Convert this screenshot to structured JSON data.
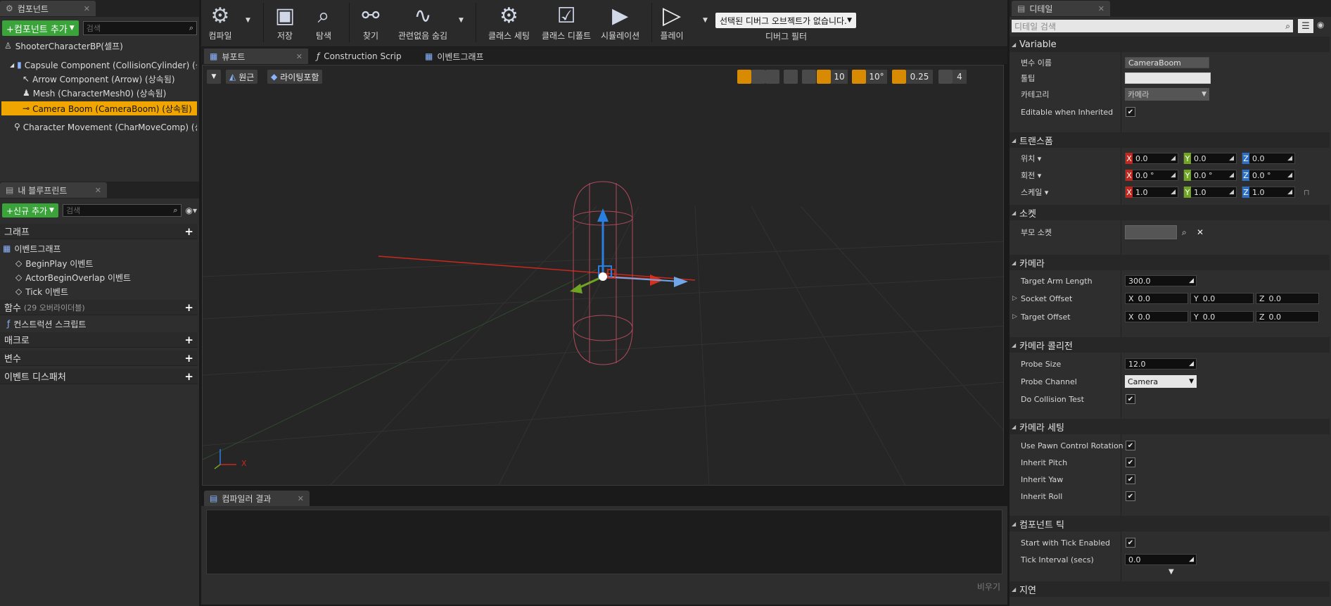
{
  "components_panel": {
    "tab_label": "컴포넌트",
    "add_button": "+컴포넌트 추가",
    "search_placeholder": "검색",
    "tree": [
      {
        "label": "ShooterCharacterBP(셀프)"
      },
      {
        "label": "Capsule Component (CollisionCylinder) (상속"
      },
      {
        "label": "Arrow Component (Arrow) (상속됨)"
      },
      {
        "label": "Mesh (CharacterMesh0) (상속됨)"
      },
      {
        "label": "Camera Boom (CameraBoom) (상속됨)"
      },
      {
        "label": "Character Movement (CharMoveComp) (상속"
      }
    ]
  },
  "blueprint_panel": {
    "tab_label": "내 블루프린트",
    "add_new": "+신규 추가",
    "search_placeholder": "검색",
    "graph_label": "그래프",
    "event_graph": "이벤트그래프",
    "events": [
      "BeginPlay 이벤트",
      "ActorBeginOverlap 이벤트",
      "Tick 이벤트"
    ],
    "functions_label": "함수",
    "functions_count": "(29 오버라이더블)",
    "construction_script": "컨스트럭션 스크립트",
    "macros_label": "매크로",
    "variables_label": "변수",
    "dispatchers_label": "이벤트 디스패처"
  },
  "toolbar": {
    "compile": "컴파일",
    "save": "저장",
    "browse": "탐색",
    "find": "찾기",
    "hide_unrelated": "관련없음 숨김",
    "class_settings": "클래스 세팅",
    "class_defaults": "클래스 디폴트",
    "simulation": "시뮬레이션",
    "play": "플레이",
    "debug_select": "선택된 디버그 오브젝트가 없습니다.",
    "debug_filter": "디버그 필터"
  },
  "center_tabs": {
    "viewport": "뷰포트",
    "construction": "Construction Scrip",
    "event_graph": "이벤트그래프"
  },
  "viewport": {
    "perspective": "원근",
    "lighting": "라이팅포함",
    "grid_snap": "10",
    "rot_snap": "10°",
    "scale_snap": "0.25",
    "cam_speed": "4",
    "axis_x": "X"
  },
  "compiler": {
    "tab_label": "컴파일러 결과",
    "clear": "비우기"
  },
  "details": {
    "tab_label": "디테일",
    "search_placeholder": "디테일 검색",
    "variable_section": "Variable",
    "var_name_label": "변수 이름",
    "var_name_value": "CameraBoom",
    "tooltip_label": "툴팁",
    "category_label": "카테고리",
    "category_value": "카메라",
    "editable_inherited": "Editable when Inherited",
    "transform_section": "트랜스폼",
    "location_label": "위치",
    "rotation_label": "회전",
    "scale_label": "스케일",
    "location": [
      "0.0",
      "0.0",
      "0.0"
    ],
    "rotation": [
      "0.0 °",
      "0.0 °",
      "0.0 °"
    ],
    "scale": [
      "1.0",
      "1.0",
      "1.0"
    ],
    "socket_section": "소켓",
    "parent_socket_label": "부모 소켓",
    "camera_section": "카메라",
    "target_arm_length_label": "Target Arm Length",
    "target_arm_length": "300.0",
    "socket_offset_label": "Socket Offset",
    "socket_offset": [
      "0.0",
      "0.0",
      "0.0"
    ],
    "target_offset_label": "Target Offset",
    "target_offset": [
      "0.0",
      "0.0",
      "0.0"
    ],
    "collision_section": "카메라 콜리전",
    "probe_size_label": "Probe Size",
    "probe_size": "12.0",
    "probe_channel_label": "Probe Channel",
    "probe_channel": "Camera",
    "do_collision_label": "Do Collision Test",
    "camera_settings_section": "카메라 세팅",
    "use_pawn_label": "Use Pawn Control Rotation",
    "inherit_pitch_label": "Inherit Pitch",
    "inherit_yaw_label": "Inherit Yaw",
    "inherit_roll_label": "Inherit Roll",
    "tick_section": "컴포넌트 틱",
    "start_tick_label": "Start with Tick Enabled",
    "tick_interval_label": "Tick Interval (secs)",
    "tick_interval": "0.0",
    "lag_section": "지연"
  },
  "colors": {
    "selection": "#f0a500",
    "green_button": "#3aa43a",
    "axis_x": "#c0281f",
    "axis_y": "#6fa522",
    "axis_z": "#2c6fc4"
  }
}
